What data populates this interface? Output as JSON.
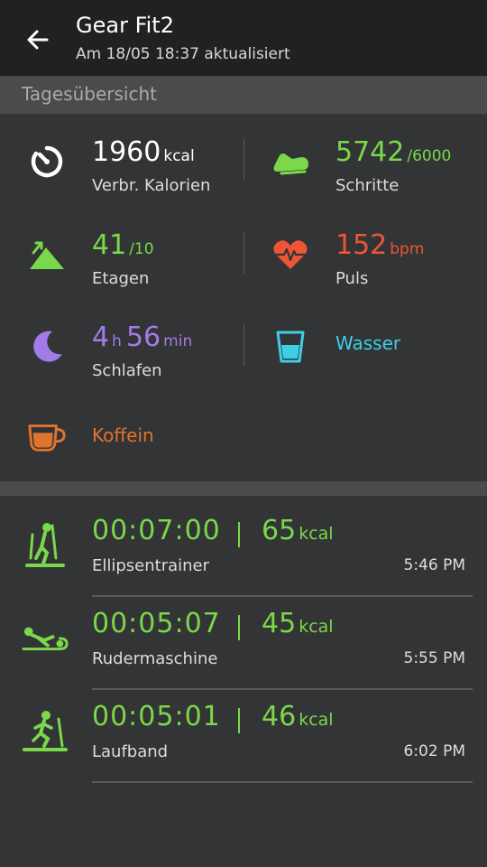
{
  "header": {
    "title": "Gear Fit2",
    "subtitle": "Am 18/05 18:37 aktualisiert"
  },
  "section": {
    "title": "Tagesübersicht"
  },
  "stats": {
    "calories": {
      "value": "1960",
      "unit": "kcal",
      "label": "Verbr. Kalorien",
      "color": "#ffffff",
      "icon": "timer-icon"
    },
    "steps": {
      "value": "5742",
      "goal": "/6000",
      "label": "Schritte",
      "color": "#7ad84a",
      "icon": "shoe-icon"
    },
    "floors": {
      "value": "41",
      "goal": "/10",
      "label": "Etagen",
      "color": "#7ad84a",
      "icon": "mountain-icon"
    },
    "pulse": {
      "value": "152",
      "unit": "bpm",
      "label": "Puls",
      "color": "#ef5535",
      "icon": "heart-icon"
    },
    "sleep": {
      "hours": "4",
      "h_unit": "h",
      "minutes": "56",
      "m_unit": "min",
      "label": "Schlafen",
      "color": "#a17be8",
      "icon": "moon-icon"
    },
    "water": {
      "label": "Wasser",
      "color": "#3ecfe6",
      "icon": "glass-icon"
    },
    "coffee": {
      "label": "Koffein",
      "color": "#e0742e",
      "icon": "cup-icon"
    }
  },
  "workouts": [
    {
      "duration": "00:07:00",
      "kcal": "65",
      "unit": "kcal",
      "name": "Ellipsentrainer",
      "time": "5:46 PM",
      "icon": "elliptical-icon"
    },
    {
      "duration": "00:05:07",
      "kcal": "45",
      "unit": "kcal",
      "name": "Rudermaschine",
      "time": "5:55 PM",
      "icon": "rowing-icon"
    },
    {
      "duration": "00:05:01",
      "kcal": "46",
      "unit": "kcal",
      "name": "Laufband",
      "time": "6:02 PM",
      "icon": "treadmill-icon"
    }
  ]
}
